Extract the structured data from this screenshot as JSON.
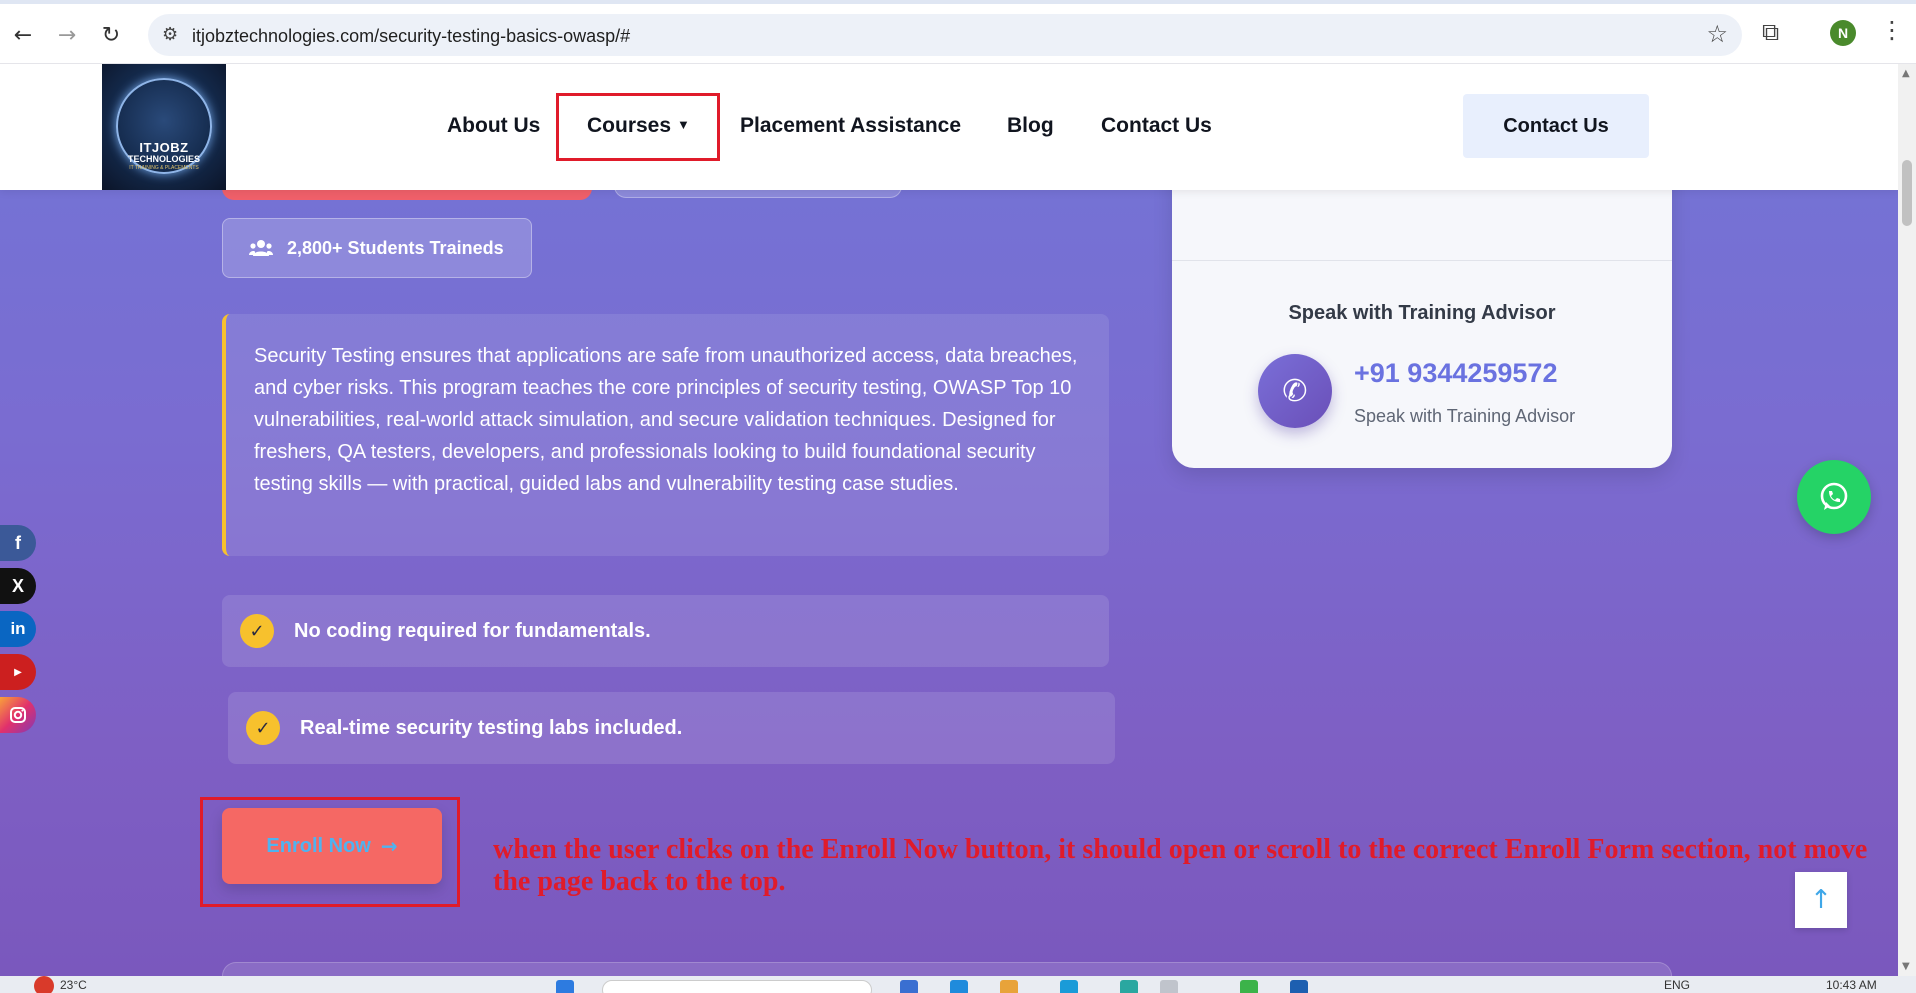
{
  "browser": {
    "url": "itjobztechnologies.com/security-testing-basics-owasp/#",
    "profile_initial": "N"
  },
  "header": {
    "logo_line1": "ITJOBZ",
    "logo_line2": "TECHNOLOGIES",
    "logo_line3": "IT TRAINING & PLACEMENTS",
    "nav": {
      "about": "About Us",
      "courses": "Courses",
      "placement": "Placement Assistance",
      "blog": "Blog",
      "contact": "Contact Us"
    },
    "contact_button": "Contact Us"
  },
  "hero": {
    "students_badge": "2,800+ Students Traineds",
    "description": "Security Testing ensures that applications are safe from unauthorized access, data breaches, and cyber risks. This program teaches the core principles of security testing, OWASP Top 10 vulnerabilities, real-world attack simulation, and secure validation techniques. Designed for freshers, QA testers, developers, and professionals looking to build foundational security testing skills — with practical, guided labs and vulnerability testing case studies.",
    "features": [
      "No coding required for fundamentals.",
      "Real-time security testing labs included."
    ],
    "enroll_button": "Enroll Now"
  },
  "advisor_card": {
    "title": "Speak with Training Advisor",
    "phone": "+91 9344259572",
    "subtitle": "Speak with Training Advisor"
  },
  "annotation": "when the user clicks on the Enroll Now button, it should open or scroll to the correct Enroll Form section, not move the page back to the top.",
  "taskbar": {
    "temperature": "23°C",
    "language": "ENG",
    "clock": "10:43 AM"
  },
  "colors": {
    "accent_red": "#f56864",
    "highlight_red": "#e01b2a",
    "check_yellow": "#f7c12d",
    "phone_blue": "#6a72e0",
    "whatsapp_green": "#25d366"
  }
}
